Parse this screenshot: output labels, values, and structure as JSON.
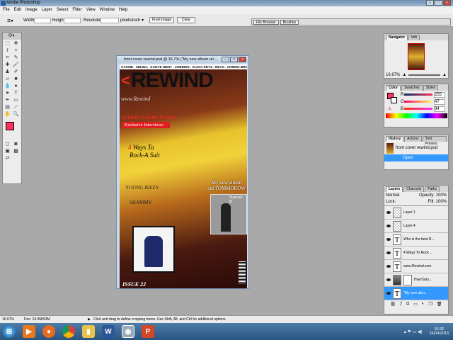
{
  "app": {
    "title": "Adobe Photoshop"
  },
  "menu": [
    "File",
    "Edit",
    "Image",
    "Layer",
    "Select",
    "Filter",
    "View",
    "Window",
    "Help"
  ],
  "options": {
    "width_label": "Width:",
    "height_label": "Height:",
    "resolution_label": "Resolution:",
    "units": "pixels/inch",
    "front_image": "Front Image",
    "clear": "Clear"
  },
  "palette_well": [
    "File Browser",
    "Brushes"
  ],
  "document": {
    "title": "front cover rewind.psd @ 16.7% (\"My new album  rel...",
    "names_strip": "CASSIE . SELINA . KANYE WEST . CHERISH . ALICIA KEYS . NEYO . CHRISH BROWN",
    "masthead": "REWIND",
    "website": "www.Rewind",
    "headline1": "10 BEST ALBUMS OF 2013",
    "exclusive": "Exclusive Interviews",
    "ways_num": "4",
    "ways": "Ways To",
    "rock": "Rock-A Suit",
    "young": "YOUNG JEEZY",
    "shammy": "SHAMMY",
    "album1": "My new album",
    "album2": "out TOMMOROW",
    "artist": "Hannah B",
    "issue": "ISSUE 22"
  },
  "navigator": {
    "tabs": [
      "Navigator",
      "Info"
    ],
    "zoom": "16.67%"
  },
  "color": {
    "tabs": [
      "Color",
      "Swatches",
      "Styles"
    ],
    "r_label": "R",
    "g_label": "G",
    "b_label": "B",
    "r": "255",
    "g": "47",
    "b": "94",
    "fg": "#ff2f5e"
  },
  "history": {
    "tabs": [
      "History",
      "Actions",
      "Tool Presets"
    ],
    "snapshot": "front cover rewind.psd",
    "items": [
      "Open"
    ]
  },
  "layers": {
    "tabs": [
      "Layers",
      "Channels",
      "Paths"
    ],
    "blend": "Normal",
    "opacity_label": "Opacity:",
    "opacity": "100%",
    "lock_label": "Lock:",
    "fill_label": "Fill:",
    "fill": "100%",
    "items": [
      "Layer 1",
      "Layer 4",
      "Who is the best R...",
      "4 Ways To  Rock ...",
      "www.Rewind.com",
      "Hue/Satu...",
      "\"My new albu..."
    ]
  },
  "status": {
    "zoom": "16.67%",
    "doc": "Doc: 24.9M/63M",
    "hint": "Click and drag to define cropping frame. Use Shift, Alt, and Ctrl for additional options."
  },
  "taskbar": {
    "time": "10:32",
    "date": "16/04/2013"
  }
}
